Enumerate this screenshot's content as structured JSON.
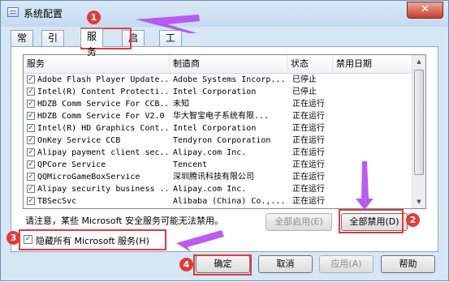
{
  "window": {
    "title": "系统配置",
    "close_label": "✕"
  },
  "tabs": [
    "常规",
    "引导",
    "服务",
    "启动",
    "工具"
  ],
  "active_tab": "服务",
  "table": {
    "headers": [
      "服务",
      "制造商",
      "状态",
      "禁用日期"
    ],
    "rows": [
      {
        "checked": true,
        "service": "Adobe Flash Player Update...",
        "maker": "Adobe Systems Incorp...",
        "status": "已停止",
        "date": ""
      },
      {
        "checked": true,
        "service": "Intel(R) Content Protecti...",
        "maker": "Intel Corporation",
        "status": "已停止",
        "date": ""
      },
      {
        "checked": true,
        "service": "HDZB Comm Service For CCB...",
        "maker": "未知",
        "status": "正在运行",
        "date": ""
      },
      {
        "checked": true,
        "service": "HDZB Comm Service For V2.0",
        "maker": "华大智宝电子系统有限...",
        "status": "正在运行",
        "date": ""
      },
      {
        "checked": true,
        "service": "Intel(R) HD Graphics Cont...",
        "maker": "Intel Corporation",
        "status": "正在运行",
        "date": ""
      },
      {
        "checked": true,
        "service": "OnKey Service CCB",
        "maker": "Tendyron Corporation",
        "status": "正在运行",
        "date": ""
      },
      {
        "checked": true,
        "service": "Alipay payment client sec...",
        "maker": "Alipay.com Inc.",
        "status": "正在运行",
        "date": ""
      },
      {
        "checked": true,
        "service": "QPCore Service",
        "maker": "Tencent",
        "status": "正在运行",
        "date": ""
      },
      {
        "checked": true,
        "service": "QQMicroGameBoxService",
        "maker": "深圳腾讯科技有限公司",
        "status": "正在运行",
        "date": ""
      },
      {
        "checked": true,
        "service": "Alipay security business ...",
        "maker": "Alipay.com Inc.",
        "status": "正在运行",
        "date": ""
      },
      {
        "checked": true,
        "service": "TBSecSvc",
        "maker": "Alibaba (China) Co.,...",
        "status": "正在运行",
        "date": ""
      }
    ]
  },
  "note": "请注意，某些 Microsoft 安全服务可能无法禁用。",
  "buttons": {
    "enable_all": "全部启用(E)",
    "disable_all": "全部禁用(D)",
    "ok": "确定",
    "cancel": "取消",
    "apply": "应用(A)",
    "help": "帮助"
  },
  "hide_ms": {
    "checked": true,
    "label": "隐藏所有 Microsoft 服务(H)"
  },
  "annotations": [
    "1",
    "2",
    "3",
    "4"
  ],
  "colors": {
    "annotation": "#e23a3a",
    "arrow": "#b24ff0",
    "title_bg": "#d6e6f5"
  }
}
